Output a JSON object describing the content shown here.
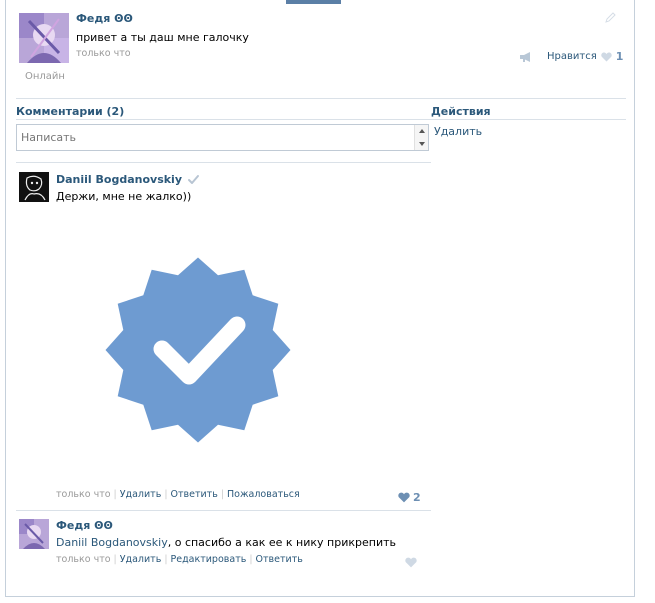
{
  "post": {
    "author": "Федя ꙨꙨ",
    "text": "привет а ты даш мне галочку",
    "time": "только что",
    "status": "Онлайн",
    "like_label": "Нравится",
    "like_count": "1"
  },
  "comments_section": {
    "title": "Комментарии (2)",
    "input_placeholder": "Написать"
  },
  "actions_section": {
    "title": "Действия",
    "delete": "Удалить"
  },
  "comments": [
    {
      "author": "Daniil Bogdanovskiy",
      "text": "Держи, мне не жалко))",
      "time": "только что",
      "actions": [
        "Удалить",
        "Ответить",
        "Пожаловаться"
      ],
      "like_count": "2"
    },
    {
      "author": "Федя ꙨꙨ",
      "mention": "Daniil Bogdanovskiy",
      "text": ", о спасибо а как ее к нику прикрепить",
      "time": "только что",
      "actions": [
        "Удалить",
        "Редактировать",
        "Ответить"
      ]
    }
  ],
  "colors": {
    "link": "#2b587a",
    "verified_badge": "#6e9bd1",
    "like": "#6d8fb3"
  }
}
